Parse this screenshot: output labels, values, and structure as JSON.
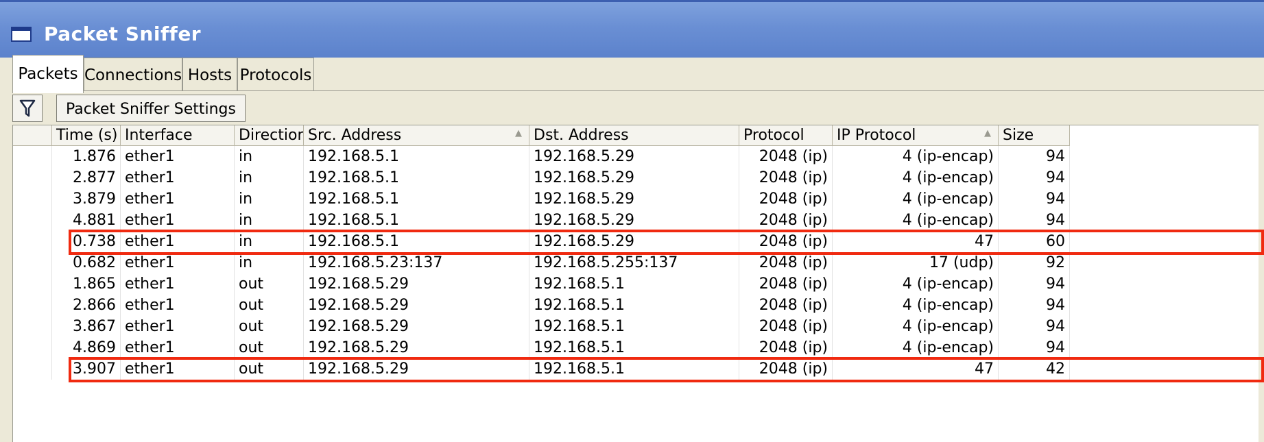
{
  "window": {
    "title": "Packet Sniffer"
  },
  "tabs": [
    {
      "label": "Packets",
      "active": true
    },
    {
      "label": "Connections",
      "active": false
    },
    {
      "label": "Hosts",
      "active": false
    },
    {
      "label": "Protocols",
      "active": false
    }
  ],
  "toolbar": {
    "filter_icon": "filter-funnel-icon",
    "settings_label": "Packet Sniffer Settings"
  },
  "table": {
    "columns": [
      "",
      "Time (s)",
      "Interface",
      "Direction",
      "Src. Address",
      "Dst. Address",
      "Protocol",
      "IP Protocol",
      "Size"
    ],
    "sorted_columns": [
      "Src. Address",
      "IP Protocol"
    ],
    "rows": [
      {
        "time": "1.876",
        "interface": "ether1",
        "direction": "in",
        "src": "192.168.5.1",
        "dst": "192.168.5.29",
        "protocol": "2048 (ip)",
        "ip_protocol": "4 (ip-encap)",
        "size": "94"
      },
      {
        "time": "2.877",
        "interface": "ether1",
        "direction": "in",
        "src": "192.168.5.1",
        "dst": "192.168.5.29",
        "protocol": "2048 (ip)",
        "ip_protocol": "4 (ip-encap)",
        "size": "94"
      },
      {
        "time": "3.879",
        "interface": "ether1",
        "direction": "in",
        "src": "192.168.5.1",
        "dst": "192.168.5.29",
        "protocol": "2048 (ip)",
        "ip_protocol": "4 (ip-encap)",
        "size": "94"
      },
      {
        "time": "4.881",
        "interface": "ether1",
        "direction": "in",
        "src": "192.168.5.1",
        "dst": "192.168.5.29",
        "protocol": "2048 (ip)",
        "ip_protocol": "4 (ip-encap)",
        "size": "94"
      },
      {
        "time": "0.738",
        "interface": "ether1",
        "direction": "in",
        "src": "192.168.5.1",
        "dst": "192.168.5.29",
        "protocol": "2048 (ip)",
        "ip_protocol": "47",
        "size": "60"
      },
      {
        "time": "0.682",
        "interface": "ether1",
        "direction": "in",
        "src": "192.168.5.23:137",
        "dst": "192.168.5.255:137",
        "protocol": "2048 (ip)",
        "ip_protocol": "17 (udp)",
        "size": "92"
      },
      {
        "time": "1.865",
        "interface": "ether1",
        "direction": "out",
        "src": "192.168.5.29",
        "dst": "192.168.5.1",
        "protocol": "2048 (ip)",
        "ip_protocol": "4 (ip-encap)",
        "size": "94"
      },
      {
        "time": "2.866",
        "interface": "ether1",
        "direction": "out",
        "src": "192.168.5.29",
        "dst": "192.168.5.1",
        "protocol": "2048 (ip)",
        "ip_protocol": "4 (ip-encap)",
        "size": "94"
      },
      {
        "time": "3.867",
        "interface": "ether1",
        "direction": "out",
        "src": "192.168.5.29",
        "dst": "192.168.5.1",
        "protocol": "2048 (ip)",
        "ip_protocol": "4 (ip-encap)",
        "size": "94"
      },
      {
        "time": "4.869",
        "interface": "ether1",
        "direction": "out",
        "src": "192.168.5.29",
        "dst": "192.168.5.1",
        "protocol": "2048 (ip)",
        "ip_protocol": "4 (ip-encap)",
        "size": "94"
      },
      {
        "time": "3.907",
        "interface": "ether1",
        "direction": "out",
        "src": "192.168.5.29",
        "dst": "192.168.5.1",
        "protocol": "2048 (ip)",
        "ip_protocol": "47",
        "size": "42"
      }
    ],
    "highlighted_rows": [
      4,
      10
    ],
    "highlight_color": "#f02a10"
  }
}
